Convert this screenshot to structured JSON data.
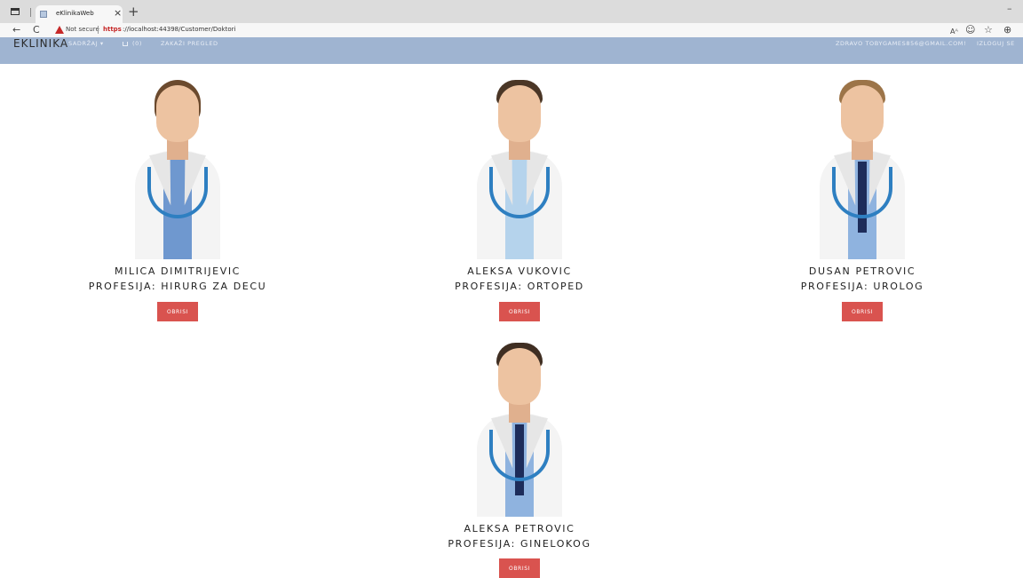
{
  "browser": {
    "tab_title": "eKlinikaWeb",
    "tab_close": "×",
    "new_tab": "+",
    "minimize": "–",
    "security_warning": "Not secure",
    "url_protocol": "https",
    "url_rest": "://localhost:44398/Customer/Doktori",
    "nav_back": "←",
    "nav_refresh": "C",
    "icons": {
      "read_aloud": "Aᴬ",
      "settings": "☺",
      "favorites": "☆",
      "collections": "⊕"
    }
  },
  "navbar": {
    "brand": "EKLINIKA",
    "menu_sadrzaj": "SADRŽAJ ▾",
    "cart_count": "(0)",
    "menu_zakazi": "ZAKAŽI PREGLED",
    "user_greeting": "ZDRAVO TOBYGAMES856@GMAIL.COM!",
    "logout": "IZLOGUJ SE"
  },
  "doctors": [
    {
      "name": "MILICA DIMITRIJEVIC",
      "profession": "PROFESIJA: HIRURG ZA DECU",
      "delete_label": "OBRISI"
    },
    {
      "name": "ALEKSA VUKOVIC",
      "profession": "PROFESIJA: ORTOPED",
      "delete_label": "OBRISI"
    },
    {
      "name": "DUSAN PETROVIC",
      "profession": "PROFESIJA: UROLOG",
      "delete_label": "OBRISI"
    },
    {
      "name": "ALEKSA PETROVIC",
      "profession": "PROFESIJA: GINELOKOG",
      "delete_label": "OBRISI"
    }
  ],
  "colors": {
    "navbar_bg": "#9fb4d1",
    "delete_button": "#d9534f"
  }
}
